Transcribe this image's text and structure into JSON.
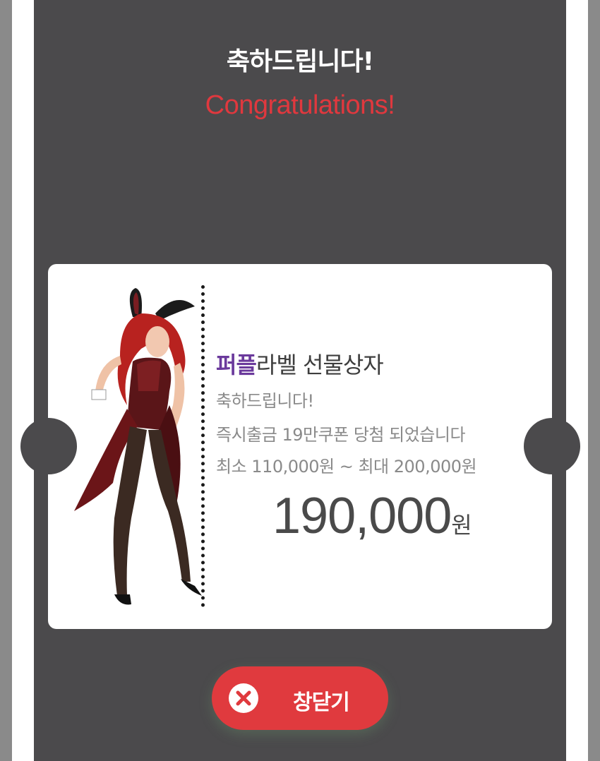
{
  "header": {
    "title_ko": "축하드립니다!",
    "title_en": "Congratulations!"
  },
  "ticket": {
    "brand": "퍼플",
    "title_rest": "라벨 선물상자",
    "line1": "축하드립니다!",
    "line2": "즉시출금 19만쿠폰 당첨 되었습니다",
    "line3": "최소 110,000원 ~ 최대 200,000원",
    "amount": "190,000",
    "amount_unit": "원",
    "image_icon": "bunny-girl-character-illustration"
  },
  "close_button": {
    "label": "창닫기",
    "icon": "close-icon"
  },
  "colors": {
    "modal_bg": "#4b4a4c",
    "accent_red": "#e03a3e",
    "brand_purple": "#6b3a9c",
    "title_en": "#e0383e"
  }
}
